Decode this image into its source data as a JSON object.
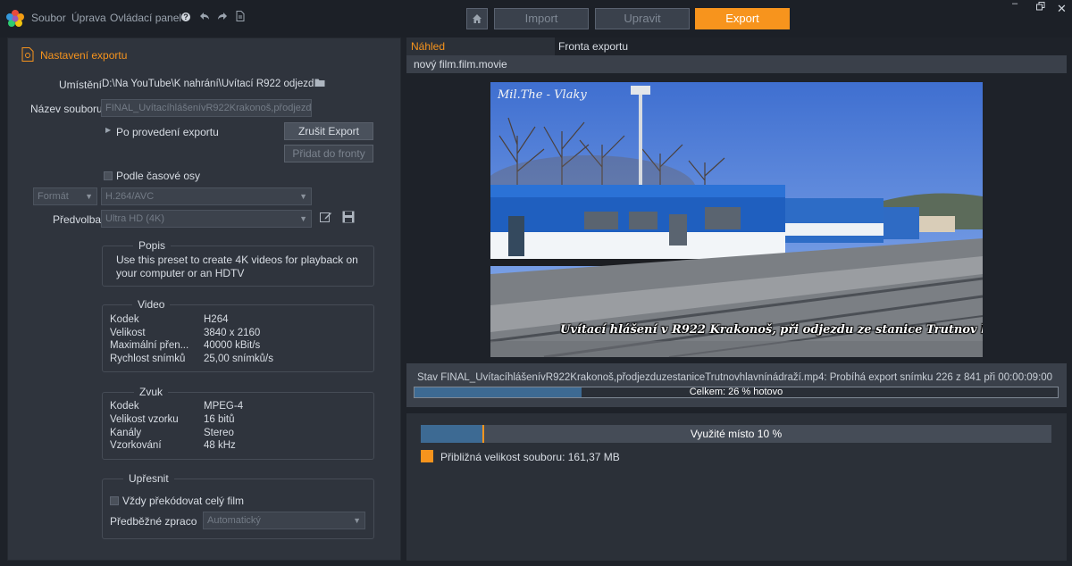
{
  "menu": {
    "file": "Soubor",
    "edit": "Úprava",
    "control_panel": "Ovládací panel"
  },
  "nav": {
    "import": "Import",
    "edit": "Upravit",
    "export": "Export"
  },
  "colors": {
    "accent": "#f7941d",
    "bg": "#1e2229",
    "panel": "#2f343d",
    "progress_fill": "#3d6a93"
  },
  "icons": [
    "app-logo-icon",
    "help-icon",
    "undo-icon",
    "redo-icon",
    "document-icon",
    "home-icon",
    "folder-icon",
    "edit-icon",
    "save-icon"
  ],
  "export_settings": {
    "title": "Nastavení exportu",
    "location_label": "Umístění",
    "location_value": "D:\\Na YouTube\\K nahrání\\Uvítací R922 odjezd...",
    "filename_label": "Název souboru",
    "filename_value": "FINAL_UvítacíhlášenívR922Krakonoš,přodjezd",
    "after_export_label": "Po provedení exportu",
    "cancel_export": "Zrušit Export",
    "add_to_queue": "Přidat do fronty",
    "timeline_label": "Podle časové osy",
    "format_label": "Formát",
    "format_value": "H.264/AVC",
    "preset_label": "Předvolba",
    "preset_value": "Ultra HD (4K)"
  },
  "description": {
    "title": "Popis",
    "text": "Use this preset to create 4K videos for playback on your computer or an HDTV"
  },
  "video": {
    "title": "Video",
    "rows": [
      {
        "k": "Kodek",
        "v": "H264"
      },
      {
        "k": "Velikost",
        "v": "3840 x 2160"
      },
      {
        "k": "Maximální přen...",
        "v": "40000 kBit/s"
      },
      {
        "k": "Rychlost snímků",
        "v": "25,00 snímků/s"
      }
    ]
  },
  "audio": {
    "title": "Zvuk",
    "rows": [
      {
        "k": "Kodek",
        "v": "MPEG-4"
      },
      {
        "k": "Velikost vzorku",
        "v": "16 bitů"
      },
      {
        "k": "Kanály",
        "v": "Stereo"
      },
      {
        "k": "Vzorkování",
        "v": "48 kHz"
      }
    ]
  },
  "refine": {
    "title": "Upřesnit",
    "always_recode": "Vždy překódovat celý film",
    "prerender_label": "Předběžné zpraco",
    "prerender_value": "Automatický"
  },
  "tabs": {
    "preview": "Náhled",
    "queue": "Fronta exportu"
  },
  "movie_name": "nový film.film.movie",
  "preview_caption": "Uvítací hlášení v R922 Krakonoš, při odjezdu ze stanice Trutnov hlavní nádraží.",
  "preview_watermark": "Mil.The - Vlaky",
  "status_text": "Stav FINAL_UvítacíhlášenívR922Krakonoš,přodjezduzestaniceTrutnovhlavnínádraží.mp4: Probíhá export snímku 226 z 841 při 00:00:09:00",
  "total_progress": {
    "label": "Celkem: 26 % hotovo",
    "fraction": 0.26
  },
  "space_used": {
    "label": "Využité místo 10 %",
    "fraction": 0.1
  },
  "file_size_label": "Přibližná velikost souboru: 161,37 MB"
}
